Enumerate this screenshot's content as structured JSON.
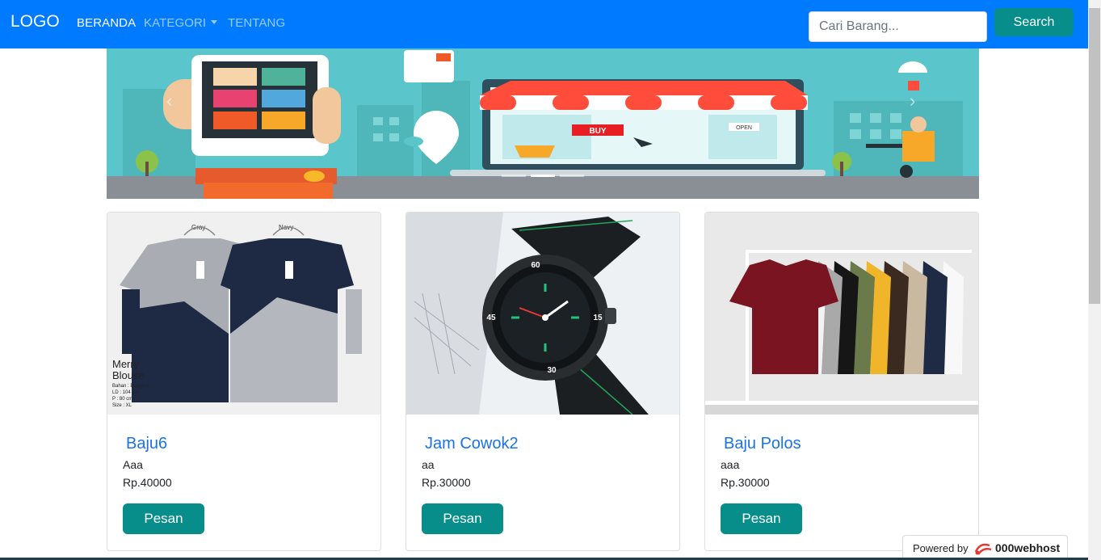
{
  "navbar": {
    "brand": "LOGO",
    "links": [
      {
        "label": "BERANDA",
        "active": true
      },
      {
        "label": "KATEGORI",
        "dropdown": true
      },
      {
        "label": "TENTANG"
      }
    ],
    "search": {
      "placeholder": "Cari Barang...",
      "value": "",
      "button_label": "Search"
    }
  },
  "carousel": {
    "slide_text": {
      "buy": "BUY",
      "open": "OPEN"
    },
    "indicators": 3,
    "active_indicator": 1,
    "icons": [
      "chevron-left-icon",
      "chevron-right-icon"
    ]
  },
  "products": [
    {
      "name": "Baju6",
      "description": "Aaa",
      "price": "Rp.40000",
      "button": "Pesan",
      "image_text": {
        "label1": "Gray",
        "label2": "Navy",
        "title": "Merry Blouse",
        "title_line1": "Merry",
        "title_line2": "Blouse",
        "details": [
          "Bahan : Babydoll",
          "LD : 104 cm",
          "P : 80 cm",
          "Size : XL"
        ]
      }
    },
    {
      "name": "Jam Cowok2",
      "description": "aa",
      "price": "Rp.30000",
      "button": "Pesan"
    },
    {
      "name": "Baju Polos",
      "description": "aaa",
      "price": "Rp.30000",
      "button": "Pesan"
    }
  ],
  "footer_badge": {
    "text": "Powered by",
    "brand": "000webhost"
  },
  "colors": {
    "navbar": "#007bff",
    "accent": "#078e8b",
    "title": "#1a73e8",
    "banner_bg": "#5ac6cb"
  }
}
